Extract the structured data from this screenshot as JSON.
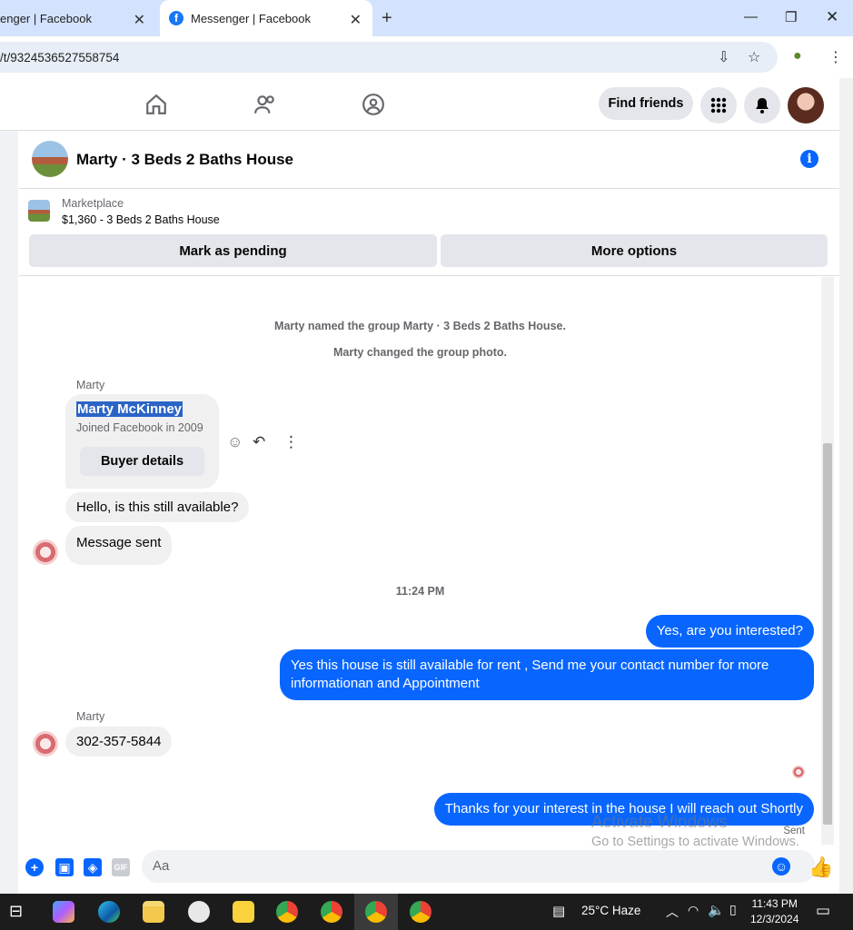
{
  "browser": {
    "tabs": [
      {
        "label": "enger | Facebook"
      },
      {
        "label": "Messenger | Facebook"
      }
    ],
    "url": "/t/9324536527558754"
  },
  "nav": {
    "find_friends": "Find friends"
  },
  "conversation": {
    "title": "Marty · 3 Beds 2 Baths House"
  },
  "marketplace": {
    "label": "Marketplace",
    "listing": "$1,360 - 3 Beds 2 Baths House",
    "mark_pending": "Mark as pending",
    "more_options": "More options"
  },
  "messages": {
    "system1": "Marty named the group Marty · 3 Beds 2 Baths House.",
    "system2": "Marty changed the group photo.",
    "sender1": "Marty",
    "profile_name": "Marty McKinney",
    "profile_joined": "Joined Facebook in 2009",
    "buyer_details": "Buyer details",
    "in1": "Hello, is this still available?",
    "in2": "Message sent",
    "timestamp": "11:24 PM",
    "out1": "Yes, are you interested?",
    "out2": "Yes this house is still available for rent , Send me your contact number for more informationan and Appointment",
    "sender2": "Marty",
    "in3": "302-357-5844",
    "out3": "Thanks for your interest in the house I will reach out Shortly",
    "status": "Sent"
  },
  "composer": {
    "placeholder": "Aa",
    "gif": "GIF"
  },
  "watermark": {
    "line1": "Activate Windows",
    "line2": "Go to Settings to activate Windows."
  },
  "taskbar": {
    "weather": "25°C  Haze",
    "time": "11:43 PM",
    "date": "12/3/2024"
  },
  "colors": {
    "accent": "#0866ff",
    "bubble_in": "#f0f0f0"
  }
}
